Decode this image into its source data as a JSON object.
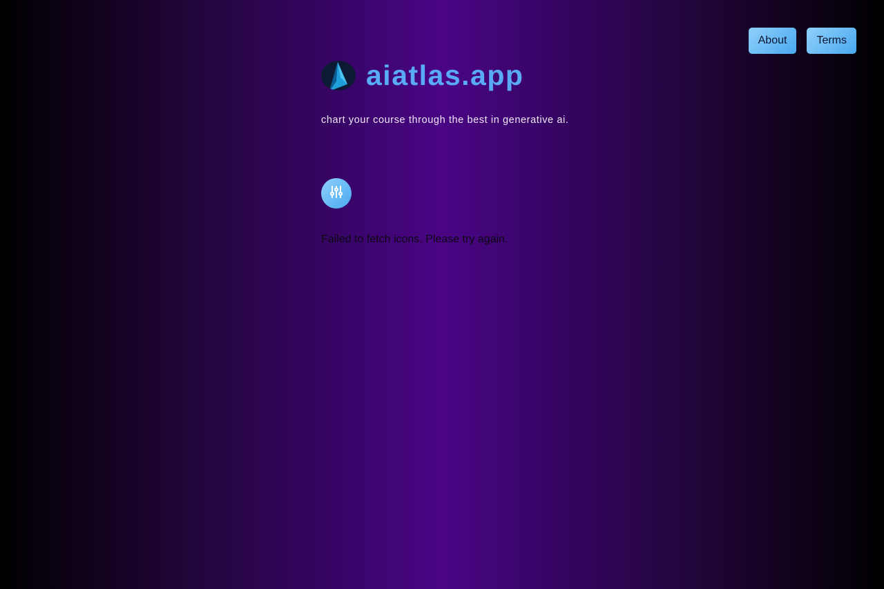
{
  "nav": {
    "about_label": "About",
    "terms_label": "Terms"
  },
  "brand": {
    "title": "aiatlas.app",
    "tagline": "chart your course through the best in generative ai.",
    "logo_icon": "compass-arrow-icon"
  },
  "filter": {
    "icon": "sliders-icon"
  },
  "status": {
    "error_message": "Failed to fetch icons. Please try again."
  },
  "colors": {
    "accent": "#5aabf5",
    "button_gradient_start": "#8fd0fb",
    "button_gradient_end": "#4aa9f0",
    "background_center": "#4a0585",
    "background_edge": "#000000"
  }
}
